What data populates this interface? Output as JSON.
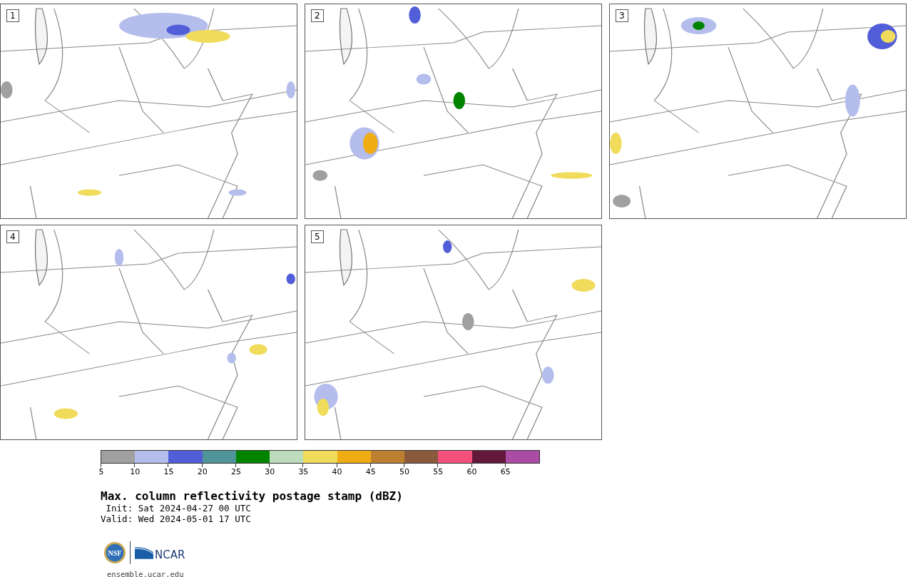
{
  "panels": [
    {
      "label": "1",
      "kind": "picture"
    },
    {
      "label": "2",
      "kind": "picture"
    },
    {
      "label": "3",
      "kind": "picture"
    },
    {
      "label": "4",
      "kind": "picture"
    },
    {
      "label": "5",
      "kind": "picture"
    }
  ],
  "colorbar": {
    "segments": [
      {
        "color": "#a0a0a0"
      },
      {
        "color": "#b4bdec"
      },
      {
        "color": "#525ed8"
      },
      {
        "color": "#4f9599"
      },
      {
        "color": "#008400"
      },
      {
        "color": "#bcdcbc"
      },
      {
        "color": "#f0dc5a"
      },
      {
        "color": "#f0ac14"
      },
      {
        "color": "#bc8030"
      },
      {
        "color": "#8a5a3c"
      },
      {
        "color": "#f4507c"
      },
      {
        "color": "#621838"
      },
      {
        "color": "#aa4ca4"
      }
    ],
    "ticks": [
      "5",
      "10",
      "15",
      "20",
      "25",
      "30",
      "35",
      "40",
      "45",
      "50",
      "55",
      "60",
      "65"
    ]
  },
  "title": "Max. column reflectivity postage stamp (dBZ)",
  "init": " Init: Sat 2024-04-27 00 UTC",
  "valid": "Valid: Wed 2024-05-01 17 UTC",
  "logo": {
    "seal_text": "NSF",
    "wordmark": "NCAR"
  },
  "footer": "ensemble.ucar.edu"
}
